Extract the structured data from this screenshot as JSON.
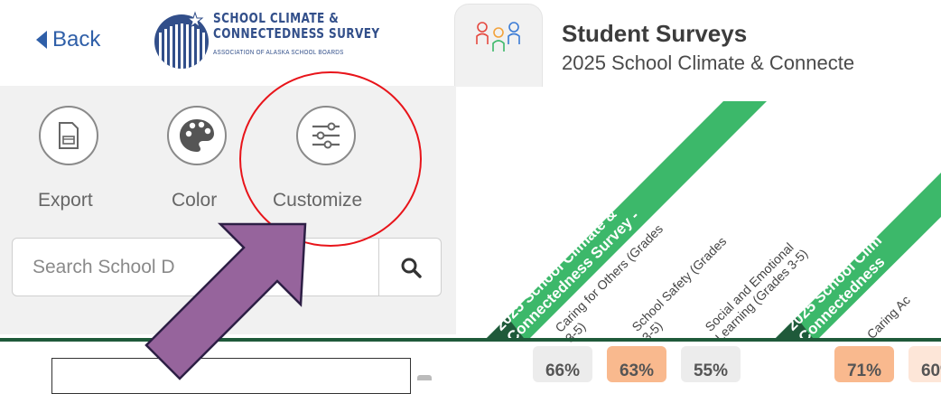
{
  "header": {
    "back_label": "Back",
    "logo": {
      "line1": "SCHOOL CLIMATE &",
      "line2": "CONNECTEDNESS SURVEY",
      "line3": "ASSOCIATION OF ALASKA SCHOOL BOARDS"
    },
    "title": "Student Surveys",
    "subtitle": "2025 School Climate & Connecte"
  },
  "toolbar": {
    "export_label": "Export",
    "color_label": "Color",
    "customize_label": "Customize"
  },
  "search": {
    "placeholder": "Search School D"
  },
  "columns": {
    "survey1_line1": "2025 School Climate &",
    "survey1_line2": "Connectedness Survey -",
    "survey1_items": [
      {
        "line1": "Caring for Others (Grades",
        "line2": "3-5)"
      },
      {
        "line1": "School Safety (Grades",
        "line2": "3-5)"
      },
      {
        "line1": "Social and Emotional",
        "line2": "Learning (Grades 3-5)"
      }
    ],
    "survey2_line1": "2025 School Clim",
    "survey2_line2": "Connectedness",
    "survey2_item": "Caring Ac"
  },
  "values": [
    "66%",
    "63%",
    "55%",
    "71%",
    "60%"
  ],
  "colors": {
    "accent_green": "#3cb86a",
    "dark_green": "#1f5a3a",
    "back_blue": "#2f5fa8",
    "highlight_red": "#e8141a",
    "arrow_purple": "#96649c",
    "cell_orange": "#f9b98e",
    "cell_gray": "#ececec"
  },
  "icons": {
    "export": "document-icon",
    "color": "palette-icon",
    "customize": "sliders-icon",
    "search": "magnifier-icon",
    "tab": "students-icon"
  }
}
